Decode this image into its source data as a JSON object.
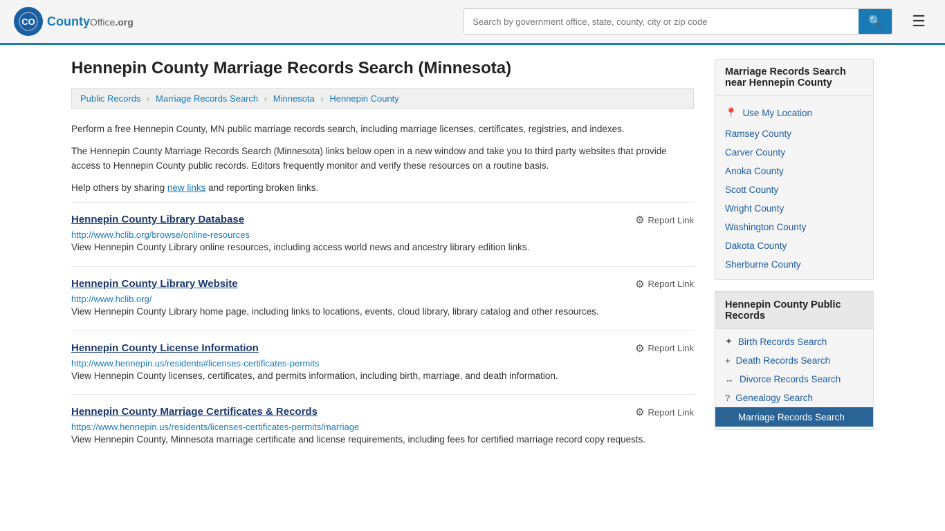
{
  "header": {
    "logo_text": "County",
    "logo_org": "Office",
    "logo_domain": ".org",
    "search_placeholder": "Search by government office, state, county, city or zip code",
    "search_value": ""
  },
  "page": {
    "title": "Hennepin County Marriage Records Search (Minnesota)",
    "breadcrumb": [
      {
        "label": "Public Records",
        "href": "#"
      },
      {
        "label": "Marriage Records Search",
        "href": "#"
      },
      {
        "label": "Minnesota",
        "href": "#"
      },
      {
        "label": "Hennepin County",
        "href": "#"
      }
    ],
    "description1": "Perform a free Hennepin County, MN public marriage records search, including marriage licenses, certificates, registries, and indexes.",
    "description2": "The Hennepin County Marriage Records Search (Minnesota) links below open in a new window and take you to third party websites that provide access to Hennepin County public records. Editors frequently monitor and verify these resources on a routine basis.",
    "description3_pre": "Help others by sharing ",
    "description3_link": "new links",
    "description3_post": " and reporting broken links."
  },
  "links": [
    {
      "title": "Hennepin County Library Database",
      "url": "http://www.hclib.org/browse/online-resources",
      "desc": "View Hennepin County Library online resources, including access world news and ancestry library edition links.",
      "report": "Report Link"
    },
    {
      "title": "Hennepin County Library Website",
      "url": "http://www.hclib.org/",
      "desc": "View Hennepin County Library home page, including links to locations, events, cloud library, library catalog and other resources.",
      "report": "Report Link"
    },
    {
      "title": "Hennepin County License Information",
      "url": "http://www.hennepin.us/residents#licenses-certificates-permits",
      "desc": "View Hennepin County licenses, certificates, and permits information, including birth, marriage, and death information.",
      "report": "Report Link"
    },
    {
      "title": "Hennepin County Marriage Certificates & Records",
      "url": "https://www.hennepin.us/residents/licenses-certificates-permits/marriage",
      "desc": "View Hennepin County, Minnesota marriage certificate and license requirements, including fees for certified marriage record copy requests.",
      "report": "Report Link"
    }
  ],
  "sidebar": {
    "nearby_title": "Marriage Records Search near Hennepin County",
    "use_location": "Use My Location",
    "nearby_counties": [
      "Ramsey County",
      "Carver County",
      "Anoka County",
      "Scott County",
      "Wright County",
      "Washington County",
      "Dakota County",
      "Sherburne County"
    ],
    "public_records_title": "Hennepin County Public Records",
    "public_records": [
      {
        "label": "Birth Records Search",
        "icon": "✦",
        "active": false
      },
      {
        "label": "Death Records Search",
        "icon": "+",
        "active": false
      },
      {
        "label": "Divorce Records Search",
        "icon": "↔",
        "active": false
      },
      {
        "label": "Genealogy Search",
        "icon": "?",
        "active": false
      },
      {
        "label": "Marriage Records Search",
        "icon": "⚭",
        "active": true
      }
    ]
  }
}
